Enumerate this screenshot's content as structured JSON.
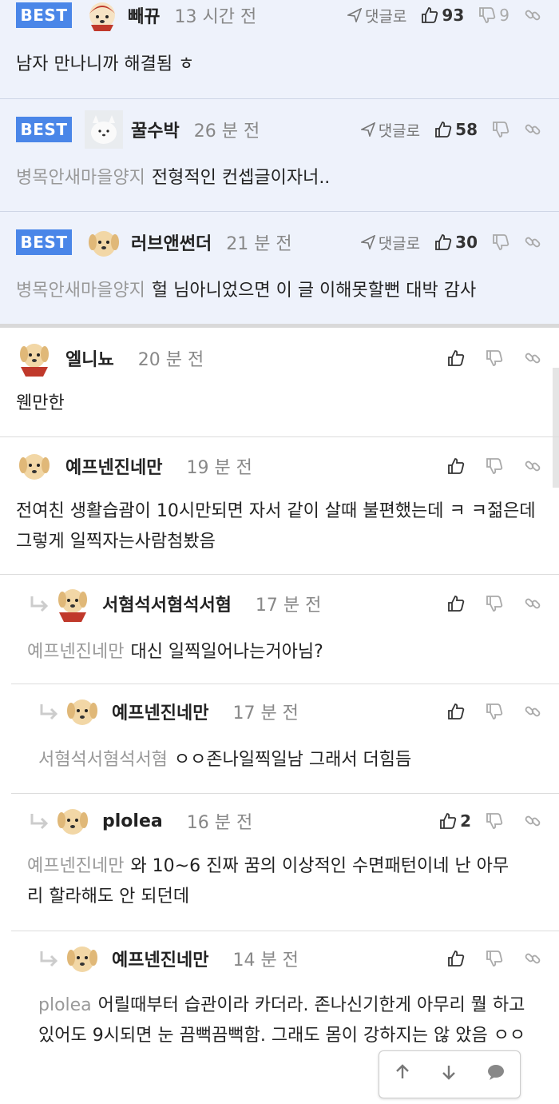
{
  "best_comments": [
    {
      "badge": "BEST",
      "nick": "빼뀨",
      "time": "13 시간 전",
      "reply_label": "댓글로",
      "likes": "93",
      "dislikes": "9",
      "mention": "",
      "text": "남자 만나니까 해결됨 ㅎ"
    },
    {
      "badge": "BEST",
      "nick": "꿀수박",
      "time": "26 분 전",
      "reply_label": "댓글로",
      "likes": "58",
      "dislikes": "",
      "mention": "병목안새마을양지",
      "text": "전형적인 컨셉글이자너.."
    },
    {
      "badge": "BEST",
      "nick": "러브앤썬더",
      "time": "21 분 전",
      "reply_label": "댓글로",
      "likes": "30",
      "dislikes": "",
      "mention": "병목안새마을양지",
      "text": "헐 님아니었으면 이 글 이해못할뻔 대박 감사"
    }
  ],
  "comments": [
    {
      "nick": "엘니뇨",
      "time": "20 분 전",
      "likes": "",
      "mention": "",
      "text": "웬만한"
    },
    {
      "nick": "예프넨진네만",
      "time": "19 분 전",
      "likes": "",
      "mention": "",
      "text": "전여친 생활습괌이 10시만되면 자서 같이 살때 불편했는데 ㅋ ㅋ젊은데 그렇게 일찍자는사람첨봤음"
    },
    {
      "nick": "서혐석서혐석서혐",
      "time": "17 분 전",
      "likes": "",
      "mention": "예프넨진네만",
      "text": "대신 일찍일어나는거아님?"
    },
    {
      "nick": "예프넨진네만",
      "time": "17 분 전",
      "likes": "",
      "mention": "서혐석서혐석서혐",
      "text": "ㅇㅇ존나일찍일남 그래서 더힘듬"
    },
    {
      "nick": "plolea",
      "time": "16 분 전",
      "likes": "2",
      "mention": "예프넨진네만",
      "text": "와 10~6 진짜 꿈의 이상적인 수면패턴이네 난 아무리 할라해도 안 되던데"
    },
    {
      "nick": "예프넨진네만",
      "time": "14 분 전",
      "likes": "",
      "mention": "plolea",
      "text": "어릴때부터 습관이라 카더라. 존나신기한게 아무리 뭘 하고있어도 9시되면 눈 끔뻑끔뻑함. 그래도 몸이 강하지는 않 았음 ㅇㅇ"
    }
  ],
  "icons": {
    "like": "thumbs-up-icon",
    "dislike": "thumbs-down-icon",
    "share": "link-icon",
    "reply": "send-icon"
  },
  "colors": {
    "badge": "#4a86e8",
    "best_bg": "#eef2fb",
    "mention": "#999999"
  }
}
